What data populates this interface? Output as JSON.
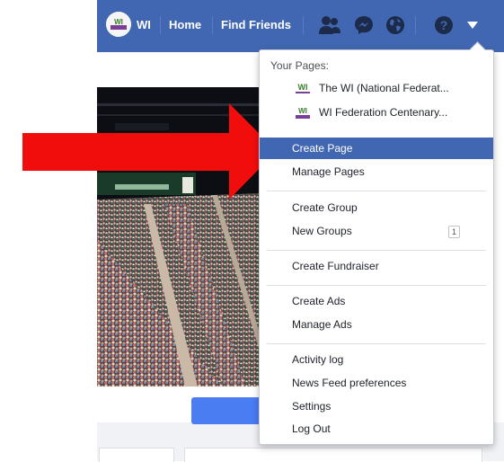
{
  "topbar": {
    "profile_name": "WI",
    "home_label": "Home",
    "find_friends_label": "Find Friends",
    "bg_color": "#4267b2"
  },
  "dropdown": {
    "pages_heading": "Your Pages:",
    "pages": [
      {
        "name": "The WI (National Federat..."
      },
      {
        "name": "WI Federation Centenary..."
      }
    ],
    "page_logo_text": "WI",
    "items": {
      "create_page": "Create Page",
      "manage_pages": "Manage Pages",
      "create_group": "Create Group",
      "new_groups": "New Groups",
      "new_groups_count": "1",
      "create_fundraiser": "Create Fundraiser",
      "create_ads": "Create Ads",
      "manage_ads": "Manage Ads",
      "activity_log": "Activity log",
      "news_feed_prefs": "News Feed preferences",
      "settings": "Settings",
      "log_out": "Log Out"
    },
    "highlight_color": "#4267b2"
  },
  "annotation": {
    "arrow_color": "#f20d0d"
  }
}
